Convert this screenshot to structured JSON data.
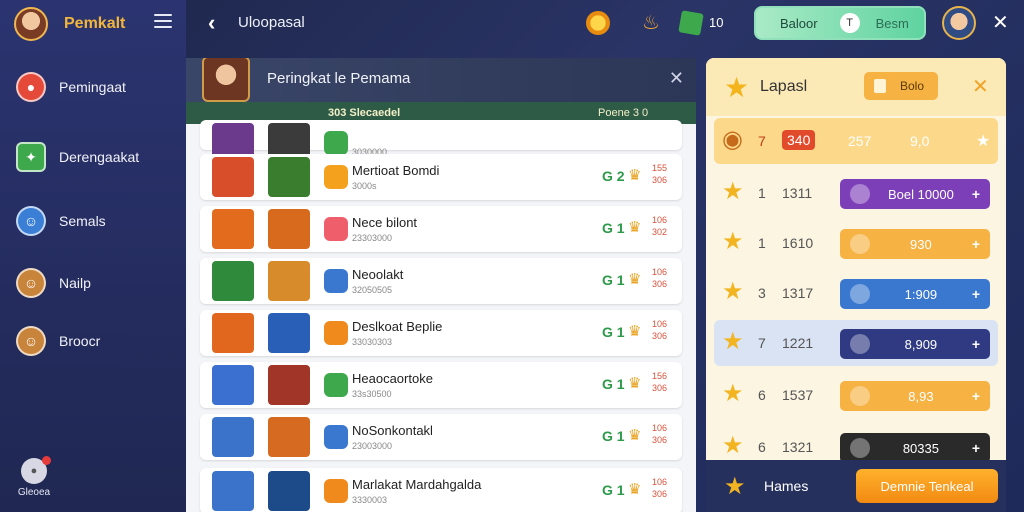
{
  "brand": {
    "name": "Pemkalt"
  },
  "sidebar": {
    "items": [
      {
        "label": "Pemingaat",
        "icon": "chat-bubble-icon",
        "color": "#e5493a"
      },
      {
        "label": "Derengaakat",
        "icon": "leaf-icon",
        "color": "#3ea84d"
      },
      {
        "label": "Semals",
        "icon": "person-icon",
        "color": "#3a7fd5"
      },
      {
        "label": "Nailp",
        "icon": "character-icon",
        "color": "#c8843a"
      },
      {
        "label": "Broocr",
        "icon": "character-icon",
        "color": "#c8843a"
      }
    ],
    "bottom_label": "Gleoea"
  },
  "topbar": {
    "title": "Uloopasal",
    "gem_count": "10",
    "toggle_left": "Baloor",
    "toggle_knob": "T",
    "toggle_right": "Besm"
  },
  "panel": {
    "title": "Peringkat le Pemama",
    "col_left": "303 Slecaedel",
    "col_right": "Poene 3 0",
    "rows": [
      {
        "name": "",
        "sub": "3030000",
        "rank": "",
        "pts_top": "",
        "pts_bot": "",
        "partial": true
      },
      {
        "name": "Mertioat Bomdi",
        "sub": "3000s",
        "rank": "G 2",
        "pts_top": "155",
        "pts_bot": "306"
      },
      {
        "name": "Nece bilont",
        "sub": "23303000",
        "rank": "G 1",
        "pts_top": "106",
        "pts_bot": "302"
      },
      {
        "name": "Neoolakt",
        "sub": "32050505",
        "rank": "G 1",
        "pts_top": "106",
        "pts_bot": "306"
      },
      {
        "name": "Deslkoat Beplie",
        "sub": "33030303",
        "rank": "G 1",
        "pts_top": "106",
        "pts_bot": "306"
      },
      {
        "name": "Heaocaortoke",
        "sub": "33s30500",
        "rank": "G 1",
        "pts_top": "156",
        "pts_bot": "306"
      },
      {
        "name": "NoSonkontakl",
        "sub": "23003000",
        "rank": "G 1",
        "pts_top": "106",
        "pts_bot": "306"
      },
      {
        "name": "Marlakat Mardahgalda",
        "sub": "3330003",
        "rank": "G 1",
        "pts_top": "106",
        "pts_bot": "306"
      }
    ]
  },
  "rpanel": {
    "title": "Lapasl",
    "tab_label": "Bolo",
    "rows": [
      {
        "num": "7",
        "val": "340",
        "extra": "257",
        "pill": "9,0",
        "pill_color": "#f7d98a"
      },
      {
        "num": "1",
        "val": "1311",
        "pill": "Boel 10000",
        "pill_color": "#7d3fb8"
      },
      {
        "num": "1",
        "val": "1610",
        "pill": "930",
        "pill_color": "#f6b243"
      },
      {
        "num": "3",
        "val": "1317",
        "pill": "1:909",
        "pill_color": "#3a78d0"
      },
      {
        "num": "7",
        "val": "1221",
        "pill": "8,909",
        "pill_color": "#2f3a83"
      },
      {
        "num": "6",
        "val": "1537",
        "pill": "8,93",
        "pill_color": "#f6b243"
      },
      {
        "num": "6",
        "val": "1321",
        "pill": "80335",
        "pill_color": "#2a2a2a"
      }
    ],
    "footer_label": "Hames",
    "cta_label": "Demnie Tenkeal"
  }
}
